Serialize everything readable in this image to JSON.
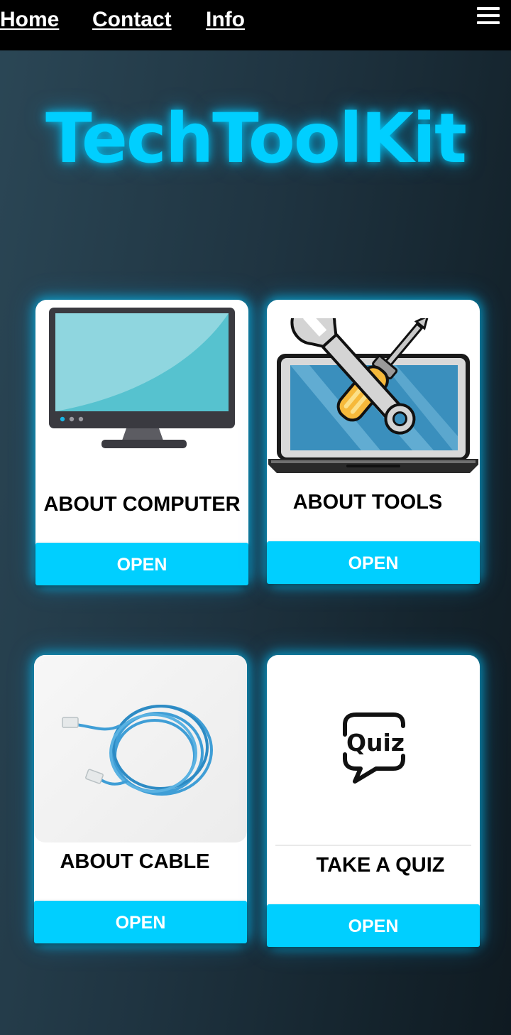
{
  "nav": {
    "home": "Home",
    "contact": "Contact",
    "info": "Info",
    "menu_icon": "hamburger-menu-icon"
  },
  "brand": {
    "title": "TechToolKit"
  },
  "cards": [
    {
      "title": "ABOUT COMPUTER",
      "button": "OPEN",
      "icon": "computer-monitor-icon"
    },
    {
      "title": "ABOUT TOOLS",
      "button": "OPEN",
      "icon": "tools-laptop-icon"
    },
    {
      "title": "ABOUT CABLE",
      "button": "OPEN",
      "icon": "network-cable-image"
    },
    {
      "title": "TAKE A QUIZ",
      "button": "OPEN",
      "icon": "quiz-speech-bubble-icon",
      "quiz_text": "Quiz"
    }
  ],
  "colors": {
    "accent": "#00cfff",
    "topbar": "#000000",
    "card": "#ffffff"
  }
}
